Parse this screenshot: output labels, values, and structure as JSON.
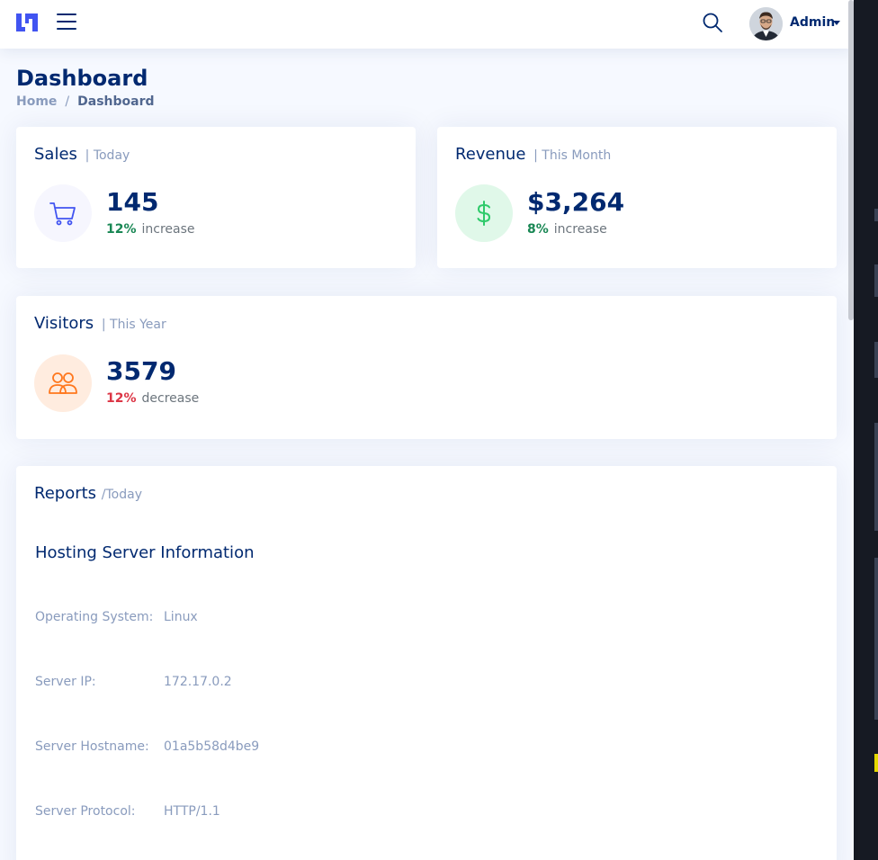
{
  "header": {
    "user_name": "Admin",
    "icons": {
      "logo": "logo-icon",
      "menu": "menu-icon",
      "search": "search-icon",
      "avatar": "user-avatar"
    }
  },
  "page": {
    "title": "Dashboard",
    "breadcrumb": {
      "home": "Home",
      "separator": "/",
      "current": "Dashboard"
    }
  },
  "cards": {
    "sales": {
      "title": "Sales",
      "period": "| Today",
      "value": "145",
      "percent": "12%",
      "trend": "increase",
      "trend_color": "#198754",
      "icon": "cart-icon",
      "icon_color": "#4154f1",
      "icon_bg": "#f6f6fe"
    },
    "revenue": {
      "title": "Revenue",
      "period": "| This Month",
      "value": "$3,264",
      "percent": "8%",
      "trend": "increase",
      "trend_color": "#198754",
      "icon": "dollar-icon",
      "icon_color": "#2eca6a",
      "icon_bg": "#e0f8e9"
    },
    "visitors": {
      "title": "Visitors",
      "period": "| This Year",
      "value": "3579",
      "percent": "12%",
      "trend": "decrease",
      "trend_color": "#dc3545",
      "icon": "people-icon",
      "icon_color": "#ff771d",
      "icon_bg": "#ffecdf"
    }
  },
  "reports": {
    "title": "Reports",
    "period": "/Today",
    "heading": "Hosting Server Information",
    "rows": [
      {
        "label": "Operating System:",
        "value": "Linux"
      },
      {
        "label": "Server IP:",
        "value": "172.17.0.2"
      },
      {
        "label": "Server Hostname:",
        "value": "01a5b58d4be9"
      },
      {
        "label": "Server Protocol:",
        "value": "HTTP/1.1"
      }
    ]
  }
}
